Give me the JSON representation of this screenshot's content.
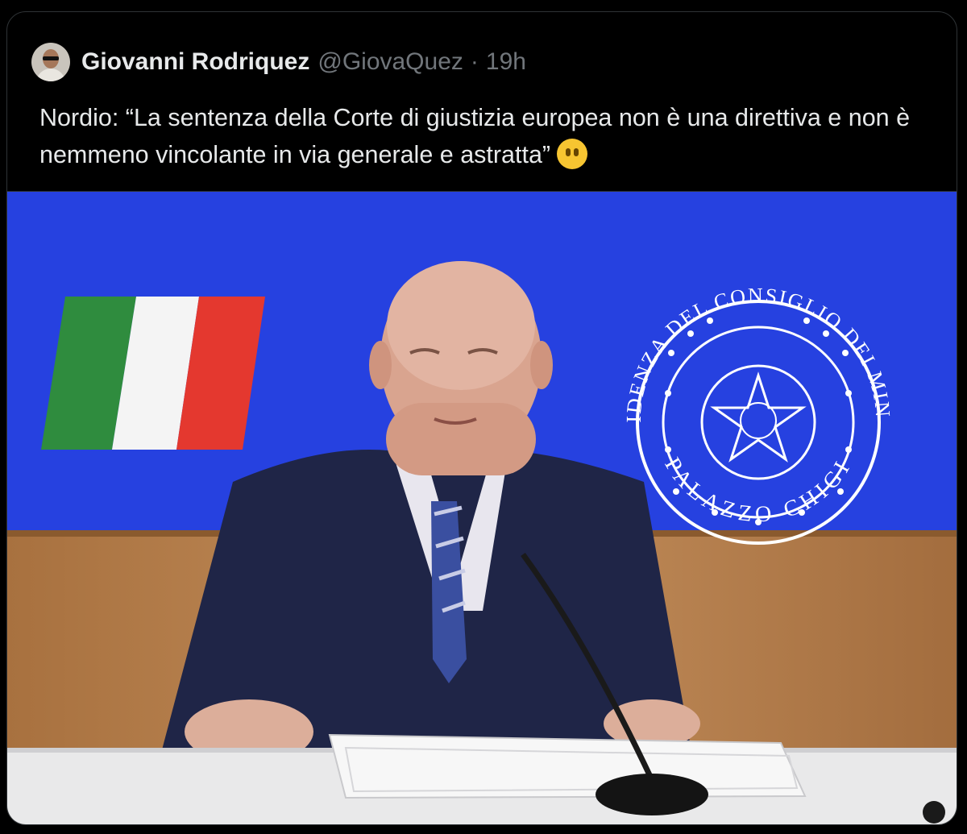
{
  "tweet": {
    "author_name": "Giovanni Rodriquez",
    "handle": "@GiovaQuez",
    "separator": "·",
    "time": "19h",
    "text": "Nordio: “La sentenza della Corte di giustizia europea non è una direttiva e non è nemmeno vincolante in via generale e astratta”",
    "emoji": "face-without-mouth-emoji"
  },
  "media": {
    "emblem_top": "PRESIDENZA DEL CONSIGLIO DEI MINISTRI",
    "emblem_bottom": "PALAZZO CHIGI"
  },
  "colors": {
    "background": "#000000",
    "text": "#e7e9ea",
    "muted": "#71767b",
    "screen_blue": "#2a46e8",
    "flag_green": "#2f8c3e",
    "flag_white": "#f4f4f4",
    "flag_red": "#e4382f",
    "wood": "#b88252",
    "suit": "#1f2547"
  }
}
